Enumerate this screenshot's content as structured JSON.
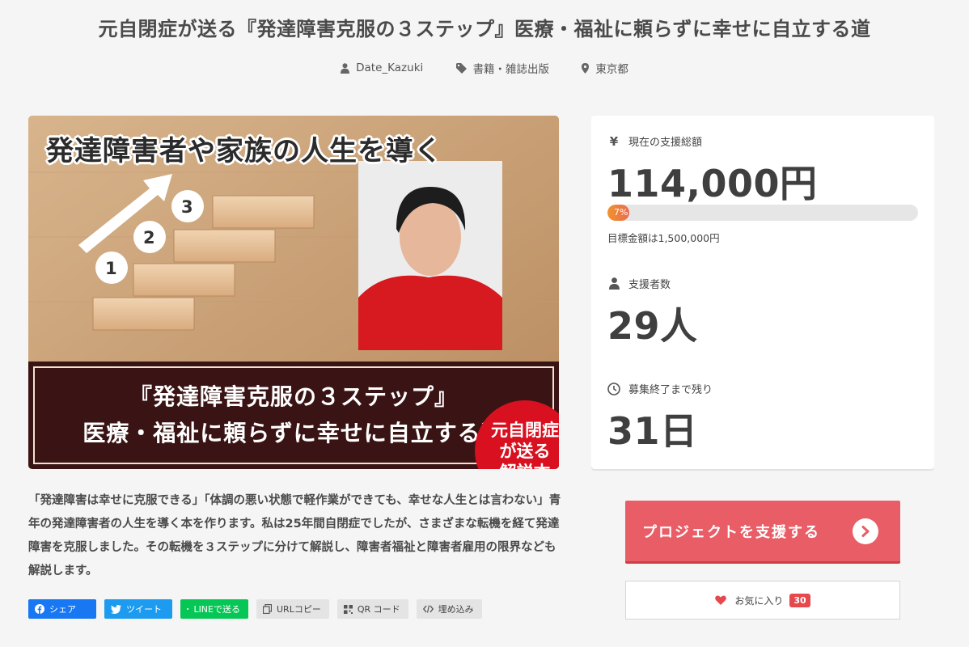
{
  "project": {
    "title": "元自閉症が送る『発達障害克服の３ステップ』医療・福祉に頼らずに幸せに自立する道",
    "owner": "Date_Kazuki",
    "category": "書籍・雑誌出版",
    "location": "東京都"
  },
  "hero": {
    "headline": "発達障害者や家族の人生を導く",
    "badge": [
      "元自閉症",
      "が送る",
      "解説本"
    ],
    "band_line1": "『発達障害克服の３ステップ』",
    "band_line2": "医療・福祉に頼らずに幸せに自立する道",
    "steps": [
      "1",
      "2",
      "3"
    ]
  },
  "description": "「発達障害は幸せに克服できる」「体調の悪い状態で軽作業ができても、幸せな人生とは言わない」青年の発達障害者の人生を導く本を作ります。私は25年間自閉症でしたが、さまざまな転機を経て発達障害を克服しました。その転機を３ステップに分けて解説し、障害者福祉と障害者雇用の限界なども解説します。",
  "share": {
    "facebook": "シェア",
    "twitter": "ツイート",
    "line": "LINEで送る",
    "url_copy": "URLコピー",
    "qr": "QR コード",
    "embed": "埋め込み"
  },
  "stats": {
    "total_label": "現在の支援総額",
    "total": "114,000円",
    "progress_label": "7%",
    "progress_fraction": 0.07,
    "goal": "目標金額は1,500,000円",
    "supporters_label": "支援者数",
    "supporters": "29人",
    "remaining_label": "募集終了まで残り",
    "remaining": "31日"
  },
  "actions": {
    "support_label": "プロジェクトを支援する",
    "favorite_label": "お気に入り",
    "favorite_count": "30"
  },
  "colors": {
    "support": "#e85d66",
    "progress": "#f1932e",
    "facebook": "#1877f2",
    "twitter": "#1d9bf0",
    "line": "#06c755"
  }
}
